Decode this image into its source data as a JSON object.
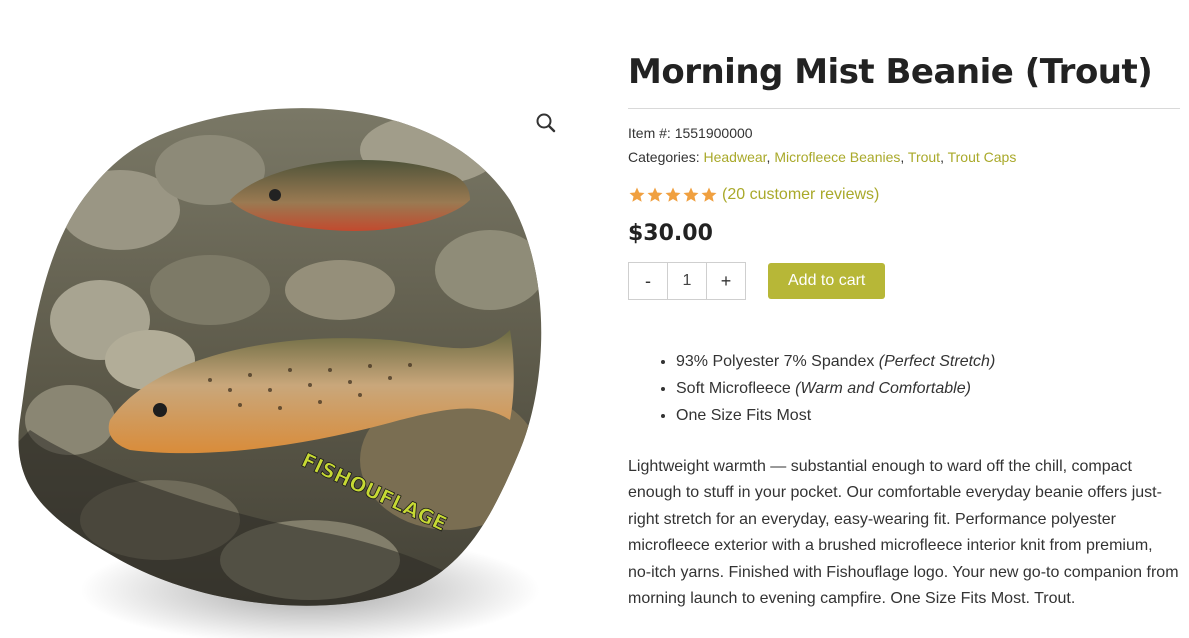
{
  "product": {
    "title": "Morning Mist Beanie (Trout)",
    "item_label": "Item #:",
    "item_number": "1551900000",
    "categories_label": "Categories:",
    "categories": [
      "Headwear",
      "Microfleece Beanies",
      "Trout",
      "Trout Caps"
    ],
    "rating": 5,
    "reviews_text": "(20 customer reviews)",
    "price": "$30.00",
    "quantity": "1",
    "qty_minus": "-",
    "qty_plus": "+",
    "add_to_cart": "Add to cart",
    "features": [
      {
        "text": "93% Polyester 7% Spandex ",
        "note": "(Perfect Stretch)"
      },
      {
        "text": "Soft Microfleece ",
        "note": "(Warm and Comfortable)"
      },
      {
        "text": "One Size Fits Most",
        "note": ""
      }
    ],
    "description": "Lightweight warmth — substantial enough to ward off the chill, compact enough to stuff in your pocket. Our comfortable everyday beanie offers just-right stretch for an everyday, easy-wearing fit. Performance polyester microfleece exterior with a brushed microfleece interior knit from premium, no-itch yarns. Finished with Fishouflage logo. Your new go-to companion from morning launch to evening campfire.  One Size Fits Most.  Trout.",
    "image_logo_text": "FISHOUFLAGE"
  },
  "colors": {
    "accent": "#b7b737",
    "link": "#a9a92a",
    "star": "#f0a040"
  },
  "icons": {
    "zoom": "search-icon",
    "star": "star-icon"
  }
}
